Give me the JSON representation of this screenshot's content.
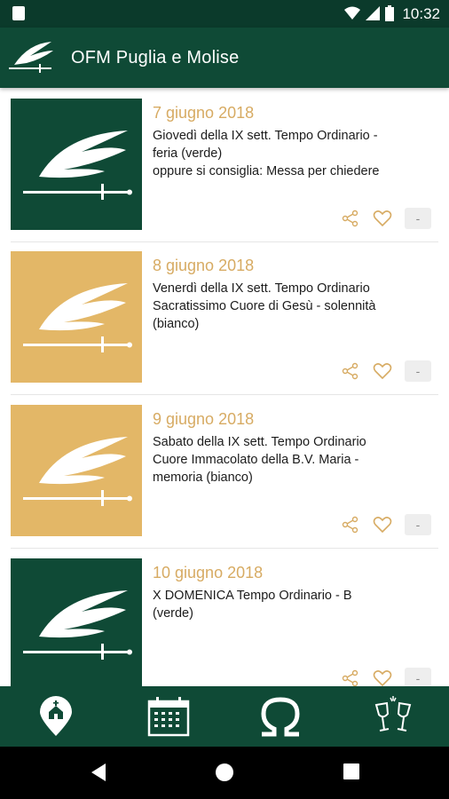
{
  "status_bar": {
    "time": "10:32"
  },
  "app": {
    "title": "OFM Puglia e Molise"
  },
  "entries": [
    {
      "date": "7 giugno 2018",
      "lines": [
        "Giovedì della IX sett. Tempo Ordinario -",
        "feria (verde)",
        "oppure si consiglia: Messa per chiedere"
      ],
      "color": "green"
    },
    {
      "date": "8 giugno 2018",
      "lines": [
        "Venerdì della IX sett. Tempo Ordinario",
        "Sacratissimo Cuore di Gesù - solennità",
        "(bianco)"
      ],
      "color": "gold"
    },
    {
      "date": "9 giugno 2018",
      "lines": [
        "Sabato della IX sett. Tempo Ordinario",
        "Cuore Immacolato della B.V. Maria -",
        "memoria (bianco)"
      ],
      "color": "gold"
    },
    {
      "date": "10 giugno 2018",
      "lines": [
        "X DOMENICA Tempo Ordinario - B",
        "(verde)"
      ],
      "color": "green"
    }
  ],
  "actions": {
    "more_label": "-"
  },
  "tabs": [
    {
      "icon": "church-pin-icon"
    },
    {
      "icon": "calendar-icon"
    },
    {
      "icon": "omega-icon"
    },
    {
      "icon": "toast-glasses-icon"
    }
  ],
  "colors": {
    "primary": "#0f4a36",
    "accent": "#e3b767",
    "date_text": "#d7ab63"
  }
}
